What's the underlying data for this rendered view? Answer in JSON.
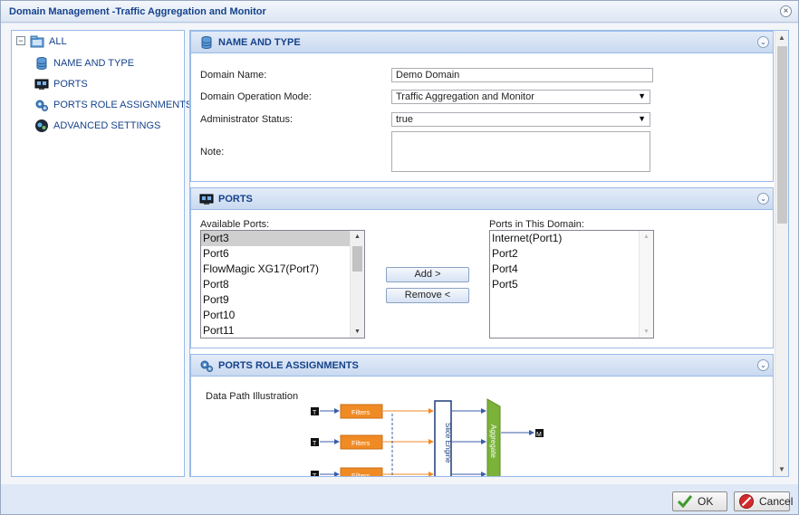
{
  "window": {
    "title": "Domain Management -Traffic Aggregation and Monitor",
    "close_glyph": "×"
  },
  "tree": {
    "expander_glyph": "−",
    "root_label": "ALL",
    "items": [
      {
        "label": "NAME AND TYPE",
        "icon": "database-icon"
      },
      {
        "label": "PORTS",
        "icon": "ports-icon"
      },
      {
        "label": "PORTS ROLE ASSIGNMENTS",
        "icon": "gears-icon"
      },
      {
        "label": "ADVANCED SETTINGS",
        "icon": "advanced-settings-icon"
      }
    ]
  },
  "name_and_type": {
    "header": "NAME AND TYPE",
    "collapse_glyph": "⌄",
    "domain_name_label": "Domain Name:",
    "domain_name_value": "Demo Domain",
    "operation_mode_label": "Domain Operation Mode:",
    "operation_mode_value": "Traffic Aggregation and Monitor",
    "admin_status_label": "Administrator Status:",
    "admin_status_value": "true",
    "note_label": "Note:",
    "dropdown_glyph": "▼"
  },
  "ports": {
    "header": "PORTS",
    "available_label": "Available Ports:",
    "available": [
      "Port3",
      "Port6",
      "FlowMagic XG17(Port7)",
      "Port8",
      "Port9",
      "Port10",
      "Port11"
    ],
    "selected_available": "Port3",
    "in_domain_label": "Ports in This Domain:",
    "in_domain": [
      "Internet(Port1)",
      "Port2",
      "Port4",
      "Port5"
    ],
    "add_label": "Add    >",
    "remove_label": "Remove <"
  },
  "role_assignments": {
    "header": "PORTS ROLE ASSIGNMENTS",
    "illustration_label": "Data Path Illustration",
    "port_tag": "T",
    "filter_label": "Filters",
    "slice_engine_label": "Slice Engine",
    "aggregate_label": "Aggregate",
    "output_tag": "M"
  },
  "scroll": {
    "up": "▲",
    "down": "▼"
  },
  "footer": {
    "ok_label": "OK",
    "cancel_label": "Cancel"
  },
  "colors": {
    "accent": "#15428b",
    "filter_orange": "#f08a24",
    "aggregate_green": "#7ab23a",
    "panel_border": "#99bbe8"
  }
}
